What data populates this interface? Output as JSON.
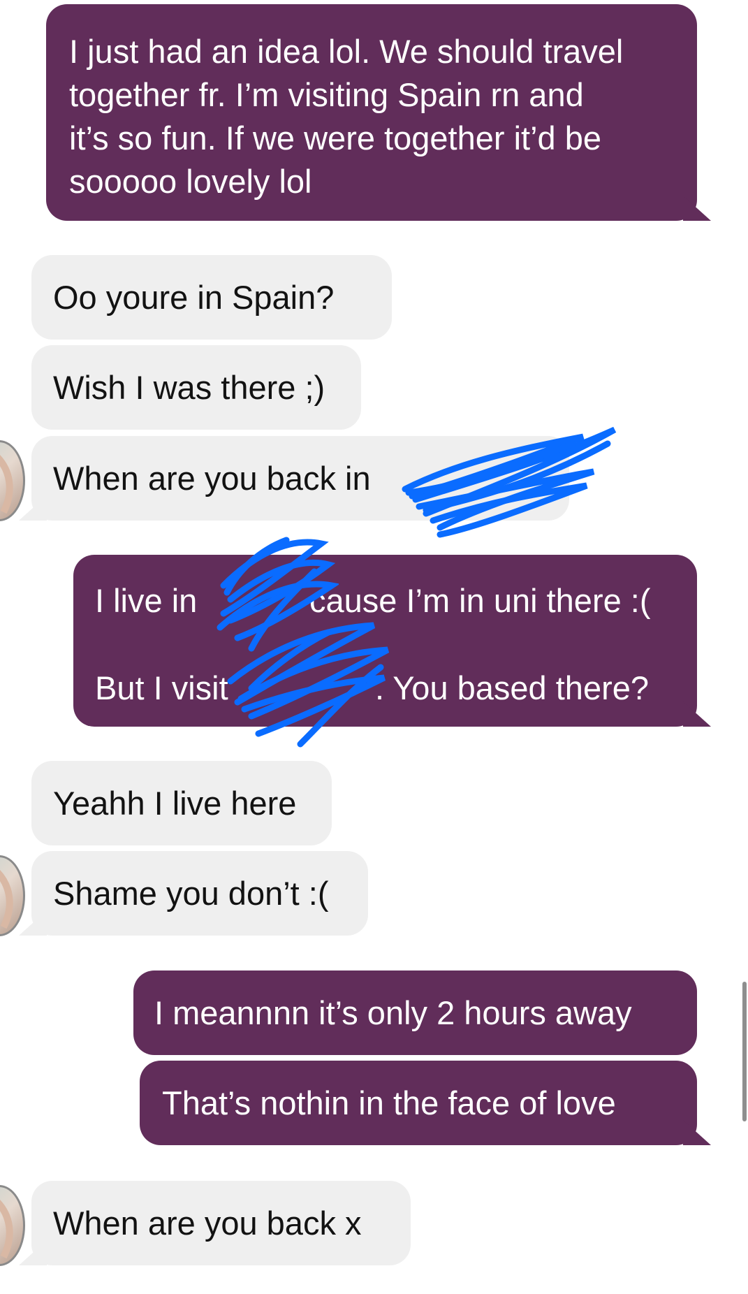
{
  "colors": {
    "outgoing_bubble": "#612d5a",
    "incoming_bubble": "#efefef",
    "redaction_scribble": "#0a6cff"
  },
  "messages": [
    {
      "direction": "outgoing",
      "lines": [
        "I just had an idea lol. We should travel",
        "together fr. I’m visiting Spain rn and",
        "it’s so fun. If we were together it’d be",
        "sooooo lovely lol"
      ]
    },
    {
      "direction": "incoming",
      "text": "Oo youre in Spain?"
    },
    {
      "direction": "incoming",
      "text": "Wish I was there ;)"
    },
    {
      "direction": "incoming",
      "text": "When are you back in"
    },
    {
      "direction": "outgoing",
      "lines": [
        "I live in",
        "cause I’m in uni there :(",
        "But I visit",
        ". You based there?"
      ]
    },
    {
      "direction": "incoming",
      "text": "Yeahh I live here"
    },
    {
      "direction": "incoming",
      "text": "Shame you don’t :("
    },
    {
      "direction": "outgoing",
      "text": "I meannnn it’s only 2 hours away"
    },
    {
      "direction": "outgoing",
      "text": "That’s nothin in the face of love"
    },
    {
      "direction": "incoming",
      "text": "When are you back x"
    }
  ],
  "icons": {
    "avatar": "profile-photo-icon",
    "redaction": "scribble-redaction-icon"
  }
}
